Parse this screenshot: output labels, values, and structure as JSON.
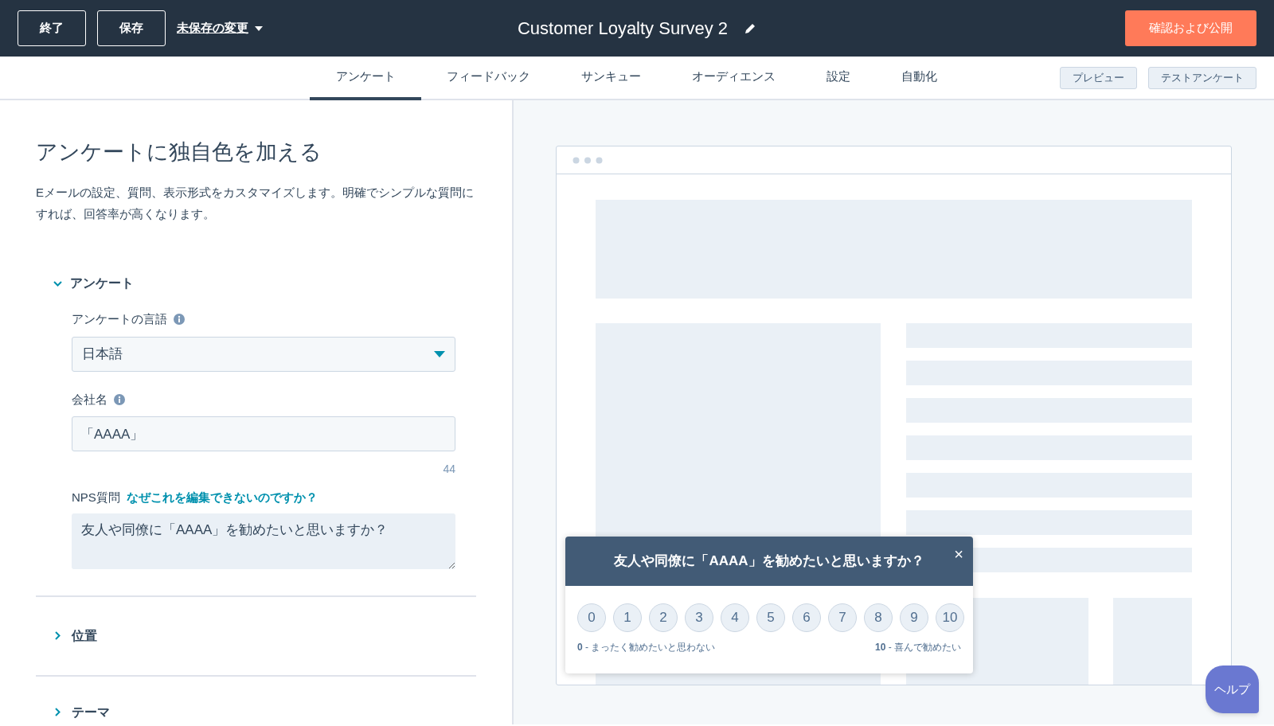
{
  "header": {
    "buttons": [
      "終了",
      "保存"
    ],
    "unsaved_menu": "未保存の変更",
    "title": "Customer Loyalty Survey 2",
    "publish_button": "確認および公開"
  },
  "tabs": [
    {
      "label": "アンケート",
      "selected": true
    },
    {
      "label": "フィードバック",
      "selected": false
    },
    {
      "label": "サンキュー",
      "selected": false
    },
    {
      "label": "オーディエンス",
      "selected": false
    },
    {
      "label": "設定",
      "selected": false
    },
    {
      "label": "自動化",
      "selected": false
    }
  ],
  "tab_actions": [
    "プレビュー",
    "テストアンケート"
  ],
  "editor": {
    "heading": "アンケートに独自色を加える",
    "description": "Eメールの設定、質問、表示形式をカスタマイズします。明確でシンプルな質問にすれば、回答率が高くなります。",
    "sections": [
      {
        "title": "アンケート",
        "expanded": true
      },
      {
        "title": "位置",
        "expanded": false
      },
      {
        "title": "テーマ",
        "expanded": false
      }
    ],
    "language": {
      "label": "アンケートの言語",
      "value": "日本語"
    },
    "company": {
      "label": "会社名",
      "value": "「AAAA」",
      "remaining": "44"
    },
    "nps": {
      "label": "NPS質問",
      "link": "なぜこれを編集できないのですか？",
      "value": "友人や同僚に「AAAA」を勧めたいと思いますか？"
    }
  },
  "preview": {
    "question": "友人や同僚に「AAAA」を勧めたいと思いますか？",
    "close": "×",
    "scale": [
      {
        "label": "0"
      },
      {
        "label": "1"
      },
      {
        "label": "2"
      },
      {
        "label": "3"
      },
      {
        "label": "4"
      },
      {
        "label": "5"
      },
      {
        "label": "6"
      },
      {
        "label": "7"
      },
      {
        "label": "8"
      },
      {
        "label": "9"
      },
      {
        "label": "10"
      }
    ],
    "low_label": "**0** - まったく勧めたいと思わない",
    "high_label": "**10** - 喜んで勧めたい"
  },
  "help_button": "ヘルプ"
}
